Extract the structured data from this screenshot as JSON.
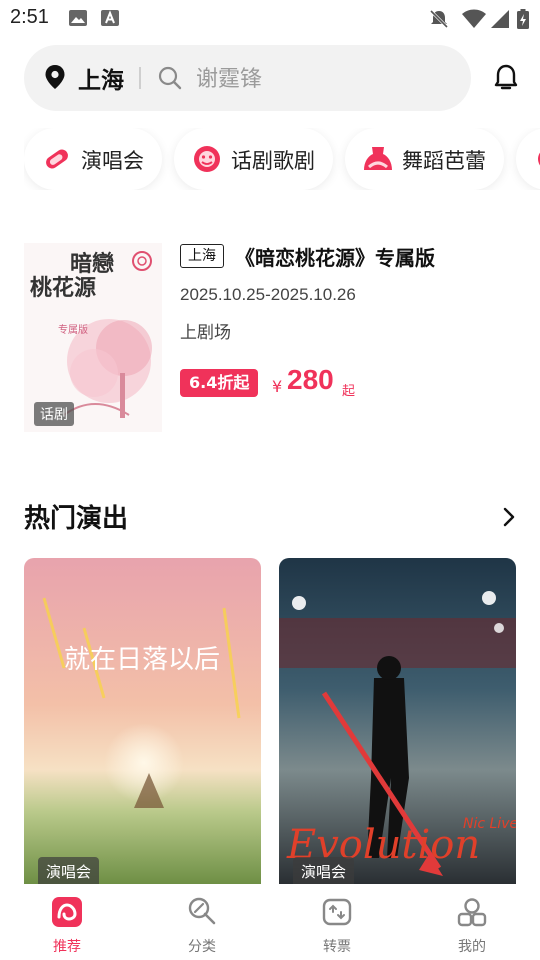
{
  "status_bar": {
    "time": "2:51",
    "icons": [
      "image-icon",
      "text-a-icon",
      "bell-off-icon",
      "wifi-icon",
      "signal-icon",
      "battery-charging-icon"
    ]
  },
  "header": {
    "city": "上海",
    "search_placeholder": "谢霆锋",
    "icons": [
      "location-pin-icon",
      "search-icon",
      "bell-icon"
    ]
  },
  "categories": [
    {
      "label": "演唱会",
      "icon": "microphone-icon"
    },
    {
      "label": "话剧歌剧",
      "icon": "mask-icon"
    },
    {
      "label": "舞蹈芭蕾",
      "icon": "ballet-skirt-icon"
    }
  ],
  "featured": {
    "city_badge": "上海",
    "title": "《暗恋桃花源》专属版",
    "date": "2025.10.25-2025.10.26",
    "venue": "上剧场",
    "discount": "6.4折起",
    "price_symbol": "¥",
    "price": "280",
    "price_suffix": "起",
    "poster_tag": "话剧",
    "poster_text": [
      "暗戀",
      "桃花源",
      "专属版"
    ]
  },
  "hot": {
    "title": "热门演出",
    "cards": [
      {
        "tag": "演唱会",
        "poster_text": "就在日落以后"
      },
      {
        "tag": "演唱会",
        "poster_text": "Evolution",
        "poster_subtext": "Nic Live"
      }
    ]
  },
  "nav": [
    {
      "label": "推荐",
      "icon": "recommend-icon",
      "active": true
    },
    {
      "label": "分类",
      "icon": "category-icon",
      "active": false
    },
    {
      "label": "转票",
      "icon": "ticket-transfer-icon",
      "active": false
    },
    {
      "label": "我的",
      "icon": "profile-icon",
      "active": false
    }
  ],
  "colors": {
    "accent": "#f0325a",
    "search_bg": "#f2f2f2"
  }
}
